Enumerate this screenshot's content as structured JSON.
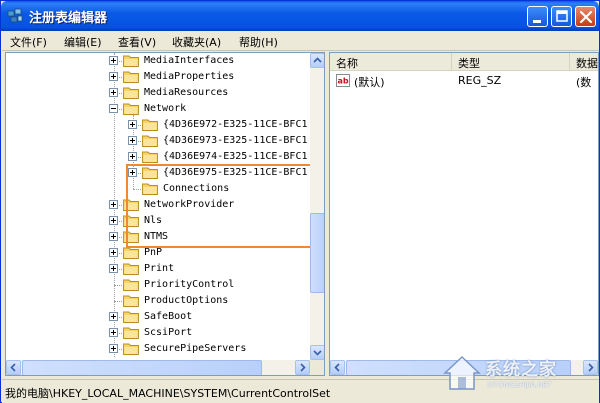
{
  "window": {
    "title": "注册表编辑器"
  },
  "menu": [
    {
      "label": "文件(F)"
    },
    {
      "label": "编辑(E)"
    },
    {
      "label": "查看(V)"
    },
    {
      "label": "收藏夹(A)"
    },
    {
      "label": "帮助(H)"
    }
  ],
  "tree": {
    "items": [
      {
        "label": "MediaInterfaces",
        "expander": "plus",
        "level": 0
      },
      {
        "label": "MediaProperties",
        "expander": "plus",
        "level": 0
      },
      {
        "label": "MediaResources",
        "expander": "plus",
        "level": 0
      },
      {
        "label": "Network",
        "expander": "minus",
        "level": 0
      },
      {
        "label": "{4D36E972-E325-11CE-BFC1",
        "expander": "plus",
        "level": 1
      },
      {
        "label": "{4D36E973-E325-11CE-BFC1",
        "expander": "plus",
        "level": 1
      },
      {
        "label": "{4D36E974-E325-11CE-BFC1",
        "expander": "plus",
        "level": 1
      },
      {
        "label": "{4D36E975-E325-11CE-BFC1",
        "expander": "plus",
        "level": 1
      },
      {
        "label": "Connections",
        "expander": "none",
        "level": 1
      },
      {
        "label": "NetworkProvider",
        "expander": "plus",
        "level": 0
      },
      {
        "label": "Nls",
        "expander": "plus",
        "level": 0
      },
      {
        "label": "NTMS",
        "expander": "plus",
        "level": 0
      },
      {
        "label": "PnP",
        "expander": "plus",
        "level": 0
      },
      {
        "label": "Print",
        "expander": "plus",
        "level": 0
      },
      {
        "label": "PriorityControl",
        "expander": "none",
        "level": 0
      },
      {
        "label": "ProductOptions",
        "expander": "none",
        "level": 0
      },
      {
        "label": "SafeBoot",
        "expander": "plus",
        "level": 0
      },
      {
        "label": "ScsiPort",
        "expander": "plus",
        "level": 0
      },
      {
        "label": "SecurePipeServers",
        "expander": "plus",
        "level": 0
      }
    ]
  },
  "list": {
    "columns": [
      {
        "label": "名称"
      },
      {
        "label": "类型"
      },
      {
        "label": "数据"
      }
    ],
    "rows": [
      {
        "name": "(默认)",
        "type": "REG_SZ",
        "data": "(数"
      }
    ]
  },
  "status": {
    "path": "我的电脑\\HKEY_LOCAL_MACHINE\\SYSTEM\\CurrentControlSet"
  },
  "watermark": {
    "text": "系统之家",
    "sub": "XITONGZHIJIA.NET"
  },
  "colors": {
    "title_bar": "#0553e1",
    "highlight": "#f08a32",
    "folder": "#f7d36a"
  }
}
